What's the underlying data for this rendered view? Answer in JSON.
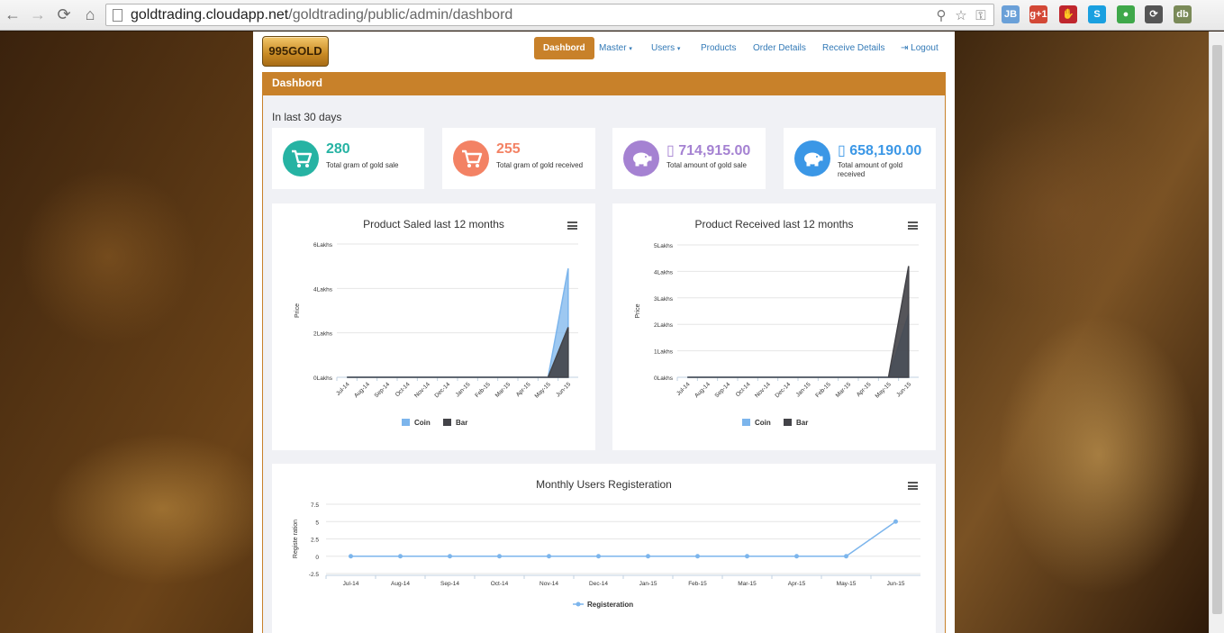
{
  "browser": {
    "url_host": "goldtrading.cloudapp.net",
    "url_path": "/goldtrading/public/admin/dashbord",
    "extensions": [
      {
        "name": "jb-extension-icon",
        "label": "JB",
        "color": "#6aa0d8"
      },
      {
        "name": "gplus-extension-icon",
        "label": "g+1",
        "color": "#d34836"
      },
      {
        "name": "adblock-extension-icon",
        "label": "✋",
        "color": "#c0262d"
      },
      {
        "name": "skype-extension-icon",
        "label": "S",
        "color": "#1aa0e0"
      },
      {
        "name": "leaf-extension-icon",
        "label": "●",
        "color": "#3fa84a"
      },
      {
        "name": "sync-extension-icon",
        "label": "⟳",
        "color": "#555555"
      },
      {
        "name": "db-extension-icon",
        "label": "db",
        "color": "#7a8a58"
      }
    ]
  },
  "app": {
    "logo": "995GOLD",
    "nav": {
      "dashboard": "Dashbord",
      "master": "Master",
      "users": "Users",
      "products": "Products",
      "order_details": "Order Details",
      "receive_details": "Receive Details",
      "logout": "Logout"
    },
    "panel_title": "Dashbord",
    "period": "In last 30 days"
  },
  "stats": [
    {
      "value": "280",
      "label": "Total gram of gold sale",
      "color": "#26b3a3",
      "icon": "cart-icon"
    },
    {
      "value": "255",
      "label": "Total gram of gold received",
      "color": "#f38264",
      "icon": "cart-icon"
    },
    {
      "value": "714,915.00",
      "label": "Total amount of gold sale",
      "color": "#a582d2",
      "icon": "piggy-bank-icon"
    },
    {
      "value": "658,190.00",
      "label": "Total amount of gold received",
      "color": "#3b97e6",
      "icon": "piggy-bank-icon"
    }
  ],
  "colors": {
    "accent": "#c8812a",
    "coin": "#7cb5ec",
    "bar": "#434348",
    "line": "#7cb5ec"
  },
  "chart_data": [
    {
      "type": "area",
      "title": "Product Saled last 12 months",
      "ylabel": "Price",
      "y_ticks": [
        "0Lakhs",
        "2Lakhs",
        "4Lakhs",
        "6Lakhs"
      ],
      "ylim": [
        0,
        6
      ],
      "categories": [
        "Jul-14",
        "Aug-14",
        "Sep-14",
        "Oct-14",
        "Nov-14",
        "Dec-14",
        "Jan-15",
        "Feb-15",
        "Mar-15",
        "Apr-15",
        "May-15",
        "Jun-15"
      ],
      "series": [
        {
          "name": "Coin",
          "values": [
            0,
            0,
            0,
            0,
            0,
            0,
            0,
            0,
            0,
            0,
            0,
            4.9
          ]
        },
        {
          "name": "Bar",
          "values": [
            0,
            0,
            0,
            0,
            0,
            0,
            0,
            0,
            0,
            0,
            0,
            2.25
          ]
        }
      ],
      "legend": "bottom-center"
    },
    {
      "type": "area",
      "title": "Product Received last 12 months",
      "ylabel": "Price",
      "y_ticks": [
        "0Lakhs",
        "1Lakhs",
        "2Lakhs",
        "3Lakhs",
        "4Lakhs",
        "5Lakhs"
      ],
      "ylim": [
        0,
        5
      ],
      "categories": [
        "Jul-14",
        "Aug-14",
        "Sep-14",
        "Oct-14",
        "Nov-14",
        "Dec-14",
        "Jan-15",
        "Feb-15",
        "Mar-15",
        "Apr-15",
        "May-15",
        "Jun-15"
      ],
      "series": [
        {
          "name": "Coin",
          "values": [
            0,
            0,
            0,
            0,
            0,
            0,
            0,
            0,
            0,
            0,
            0,
            2.4
          ]
        },
        {
          "name": "Bar",
          "values": [
            0,
            0,
            0,
            0,
            0,
            0,
            0,
            0,
            0,
            0,
            0,
            4.2
          ]
        }
      ],
      "legend": "bottom-center"
    },
    {
      "type": "line",
      "title": "Monthly Users Registeration",
      "ylabel": "Registe ration",
      "y_ticks": [
        "-2.5",
        "0",
        "2.5",
        "5",
        "7.5"
      ],
      "ylim": [
        -2.5,
        7.5
      ],
      "categories": [
        "Jul-14",
        "Aug-14",
        "Sep-14",
        "Oct-14",
        "Nov-14",
        "Dec-14",
        "Jan-15",
        "Feb-15",
        "Mar-15",
        "Apr-15",
        "May-15",
        "Jun-15"
      ],
      "series": [
        {
          "name": "Registeration",
          "values": [
            0,
            0,
            0,
            0,
            0,
            0,
            0,
            0,
            0,
            0,
            0,
            5
          ]
        }
      ],
      "legend": "bottom-center"
    }
  ]
}
